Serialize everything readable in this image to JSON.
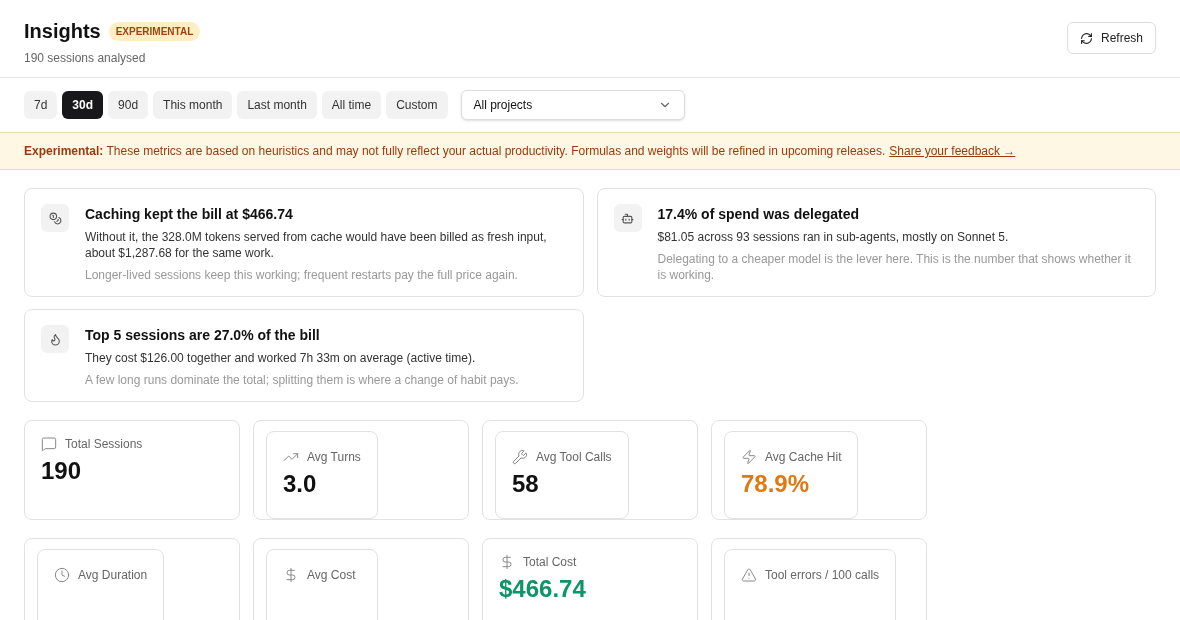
{
  "header": {
    "title": "Insights",
    "badge": "EXPERIMENTAL",
    "subtitle": "190 sessions analysed",
    "refresh_button": "Refresh"
  },
  "ranges": [
    {
      "label": "7d",
      "selected": false
    },
    {
      "label": "30d",
      "selected": true
    },
    {
      "label": "90d",
      "selected": false
    },
    {
      "label": "This month",
      "selected": false
    },
    {
      "label": "Last month",
      "selected": false
    },
    {
      "label": "All time",
      "selected": false
    },
    {
      "label": "Custom",
      "selected": false
    }
  ],
  "project_select": {
    "value": "All projects"
  },
  "banner": {
    "text": "**Experimental:** These metrics are based on heuristics and may not fully reflect your actual productivity. Formulas and weights will be refined in upcoming releases.",
    "link": "Share your feedback →"
  },
  "insights": [
    {
      "title": "Caching kept the bill at $466.74",
      "body": "Without it, the 328.0M tokens served from cache would have been billed as fresh input, about $1,287.68 for the same work.",
      "note": "Longer-lived sessions keep this working; frequent restarts pay the full price again."
    },
    {
      "title": "17.4% of spend was delegated",
      "body": "$81.05 across 93 sessions ran in sub-agents, mostly on Sonnet 5.",
      "note": "Delegating to a cheaper model is the lever here. This is the number that shows whether it is working."
    },
    {
      "title": "Top 5 sessions are 27.0% of the bill",
      "body": "They cost $126.00 together and worked 7h 33m on average (active time).",
      "note": "A few long runs dominate the total; splitting them is where a change of habit pays."
    }
  ],
  "stats": [
    {
      "kind": "plain",
      "label": "Total Sessions",
      "value": "190",
      "color": "#111111"
    },
    {
      "kind": "nested",
      "label": "Avg Turns",
      "value": "3.0",
      "color": "#111111"
    },
    {
      "kind": "nested",
      "label": "Avg Tool Calls",
      "value": "58",
      "color": "#111111"
    },
    {
      "kind": "nested",
      "label": "Avg Cache Hit",
      "value": "78.9%",
      "color": "#e07a10"
    },
    {
      "kind": "nested",
      "label": "Avg Duration"
    },
    {
      "kind": "nested",
      "label": "Avg Cost"
    },
    {
      "kind": "plain",
      "label": "Total Cost",
      "value": "$466.74",
      "color": "#0d9467"
    },
    {
      "kind": "nested",
      "label": "Tool errors / 100 calls"
    }
  ]
}
